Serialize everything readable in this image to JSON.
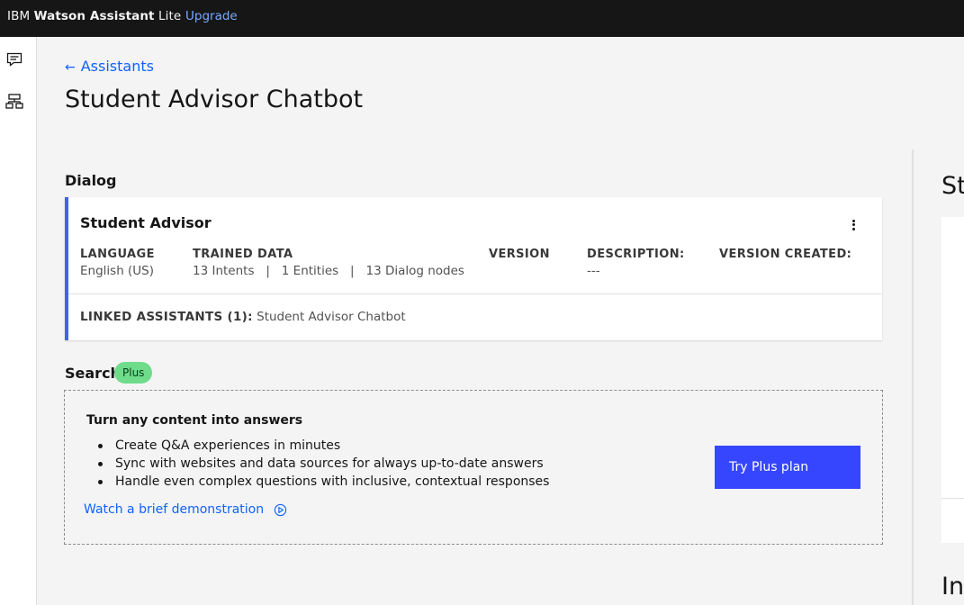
{
  "topbar": {
    "brand_prefix": "IBM",
    "brand_name": "Watson Assistant",
    "brand_suffix": "Lite",
    "upgrade_label": "Upgrade"
  },
  "leftrail": {
    "icons": [
      "chat-icon",
      "tree-structure-icon"
    ]
  },
  "header": {
    "back_label": "Assistants",
    "title": "Student Advisor Chatbot"
  },
  "dialog": {
    "section_label": "Dialog",
    "card": {
      "title": "Student Advisor",
      "columns": [
        {
          "heading": "LANGUAGE",
          "value": "English (US)"
        },
        {
          "heading": "TRAINED DATA",
          "value": "13 Intents   |   1 Entities   |   13 Dialog nodes"
        },
        {
          "heading": "VERSION",
          "value": ""
        },
        {
          "heading": "DESCRIPTION:",
          "value": "---"
        },
        {
          "heading": "VERSION CREATED:",
          "value": ""
        }
      ],
      "linked_heading": "LINKED ASSISTANTS (1):",
      "linked_value": "Student Advisor Chatbot"
    }
  },
  "search": {
    "section_label": "Search",
    "badge": "Plus",
    "title": "Turn any content into answers",
    "bullets": [
      "Create Q&A experiences in minutes",
      "Sync with websites and data sources for always up-to-date answers",
      "Handle even complex questions with inclusive, contextual responses"
    ],
    "demo_link": "Watch a brief demonstration",
    "cta_label": "Try Plus plan"
  },
  "right_panel": {
    "title_fragment": "St",
    "title_fragment_2": "In"
  },
  "colors": {
    "topbar_bg": "#161616",
    "accent_link": "#0f62fe",
    "card_accent": "#4460f1",
    "cta_bg": "#3646ff",
    "plus_badge": "#6fdc8c"
  }
}
